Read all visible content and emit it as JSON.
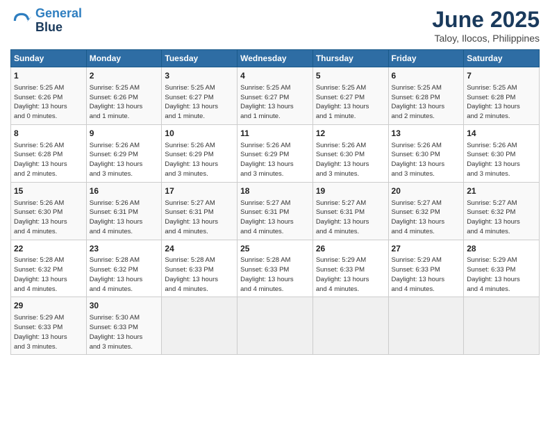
{
  "header": {
    "logo_line1": "General",
    "logo_line2": "Blue",
    "month": "June 2025",
    "location": "Taloy, Ilocos, Philippines"
  },
  "weekdays": [
    "Sunday",
    "Monday",
    "Tuesday",
    "Wednesday",
    "Thursday",
    "Friday",
    "Saturday"
  ],
  "weeks": [
    [
      {
        "day": 1,
        "info": "Sunrise: 5:25 AM\nSunset: 6:26 PM\nDaylight: 13 hours\nand 0 minutes."
      },
      {
        "day": 2,
        "info": "Sunrise: 5:25 AM\nSunset: 6:26 PM\nDaylight: 13 hours\nand 1 minute."
      },
      {
        "day": 3,
        "info": "Sunrise: 5:25 AM\nSunset: 6:27 PM\nDaylight: 13 hours\nand 1 minute."
      },
      {
        "day": 4,
        "info": "Sunrise: 5:25 AM\nSunset: 6:27 PM\nDaylight: 13 hours\nand 1 minute."
      },
      {
        "day": 5,
        "info": "Sunrise: 5:25 AM\nSunset: 6:27 PM\nDaylight: 13 hours\nand 1 minute."
      },
      {
        "day": 6,
        "info": "Sunrise: 5:25 AM\nSunset: 6:28 PM\nDaylight: 13 hours\nand 2 minutes."
      },
      {
        "day": 7,
        "info": "Sunrise: 5:25 AM\nSunset: 6:28 PM\nDaylight: 13 hours\nand 2 minutes."
      }
    ],
    [
      {
        "day": 8,
        "info": "Sunrise: 5:26 AM\nSunset: 6:28 PM\nDaylight: 13 hours\nand 2 minutes."
      },
      {
        "day": 9,
        "info": "Sunrise: 5:26 AM\nSunset: 6:29 PM\nDaylight: 13 hours\nand 3 minutes."
      },
      {
        "day": 10,
        "info": "Sunrise: 5:26 AM\nSunset: 6:29 PM\nDaylight: 13 hours\nand 3 minutes."
      },
      {
        "day": 11,
        "info": "Sunrise: 5:26 AM\nSunset: 6:29 PM\nDaylight: 13 hours\nand 3 minutes."
      },
      {
        "day": 12,
        "info": "Sunrise: 5:26 AM\nSunset: 6:30 PM\nDaylight: 13 hours\nand 3 minutes."
      },
      {
        "day": 13,
        "info": "Sunrise: 5:26 AM\nSunset: 6:30 PM\nDaylight: 13 hours\nand 3 minutes."
      },
      {
        "day": 14,
        "info": "Sunrise: 5:26 AM\nSunset: 6:30 PM\nDaylight: 13 hours\nand 3 minutes."
      }
    ],
    [
      {
        "day": 15,
        "info": "Sunrise: 5:26 AM\nSunset: 6:30 PM\nDaylight: 13 hours\nand 4 minutes."
      },
      {
        "day": 16,
        "info": "Sunrise: 5:26 AM\nSunset: 6:31 PM\nDaylight: 13 hours\nand 4 minutes."
      },
      {
        "day": 17,
        "info": "Sunrise: 5:27 AM\nSunset: 6:31 PM\nDaylight: 13 hours\nand 4 minutes."
      },
      {
        "day": 18,
        "info": "Sunrise: 5:27 AM\nSunset: 6:31 PM\nDaylight: 13 hours\nand 4 minutes."
      },
      {
        "day": 19,
        "info": "Sunrise: 5:27 AM\nSunset: 6:31 PM\nDaylight: 13 hours\nand 4 minutes."
      },
      {
        "day": 20,
        "info": "Sunrise: 5:27 AM\nSunset: 6:32 PM\nDaylight: 13 hours\nand 4 minutes."
      },
      {
        "day": 21,
        "info": "Sunrise: 5:27 AM\nSunset: 6:32 PM\nDaylight: 13 hours\nand 4 minutes."
      }
    ],
    [
      {
        "day": 22,
        "info": "Sunrise: 5:28 AM\nSunset: 6:32 PM\nDaylight: 13 hours\nand 4 minutes."
      },
      {
        "day": 23,
        "info": "Sunrise: 5:28 AM\nSunset: 6:32 PM\nDaylight: 13 hours\nand 4 minutes."
      },
      {
        "day": 24,
        "info": "Sunrise: 5:28 AM\nSunset: 6:33 PM\nDaylight: 13 hours\nand 4 minutes."
      },
      {
        "day": 25,
        "info": "Sunrise: 5:28 AM\nSunset: 6:33 PM\nDaylight: 13 hours\nand 4 minutes."
      },
      {
        "day": 26,
        "info": "Sunrise: 5:29 AM\nSunset: 6:33 PM\nDaylight: 13 hours\nand 4 minutes."
      },
      {
        "day": 27,
        "info": "Sunrise: 5:29 AM\nSunset: 6:33 PM\nDaylight: 13 hours\nand 4 minutes."
      },
      {
        "day": 28,
        "info": "Sunrise: 5:29 AM\nSunset: 6:33 PM\nDaylight: 13 hours\nand 4 minutes."
      }
    ],
    [
      {
        "day": 29,
        "info": "Sunrise: 5:29 AM\nSunset: 6:33 PM\nDaylight: 13 hours\nand 3 minutes."
      },
      {
        "day": 30,
        "info": "Sunrise: 5:30 AM\nSunset: 6:33 PM\nDaylight: 13 hours\nand 3 minutes."
      },
      null,
      null,
      null,
      null,
      null
    ]
  ]
}
